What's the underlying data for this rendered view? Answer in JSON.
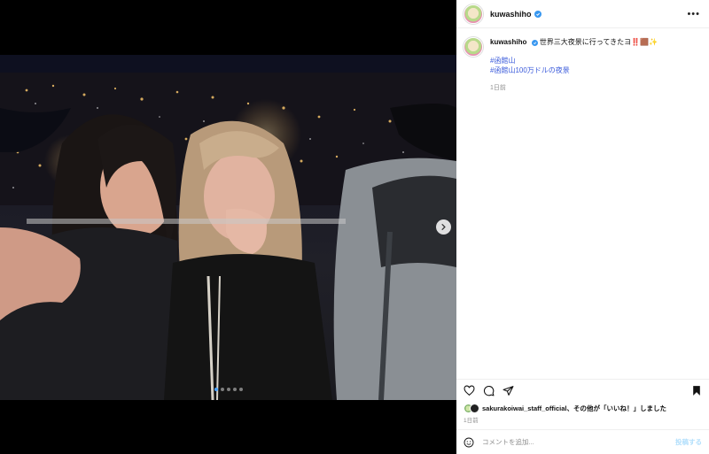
{
  "post": {
    "username": "kuwashiho",
    "caption_text": "世界三大夜景に行ってきたヨ‼️🟫✨",
    "hashtags": [
      "#函館山",
      "#函館山100万ドルの夜景"
    ],
    "posted_ago": "1日前",
    "liked_by_user": "sakurakoiwai_staff_official",
    "liked_by_suffix": "、その他が「いいね！」しました",
    "date": "1日前"
  },
  "comment": {
    "placeholder": "コメントを追加...",
    "post_label": "投稿する"
  },
  "carousel": {
    "slide_count": 5,
    "active_slide": 1
  },
  "icons": {
    "verified": "verified-badge-icon",
    "more": "more-options-icon",
    "like": "heart-icon",
    "comment": "comment-icon",
    "share": "send-icon",
    "save": "bookmark-icon",
    "emoji": "emoji-icon",
    "next": "chevron-right-icon"
  },
  "colors": {
    "accent": "#3897f0",
    "hashtag": "#3b5bdb",
    "muted": "#8e8e8e",
    "post_button": "#b2dffc"
  }
}
